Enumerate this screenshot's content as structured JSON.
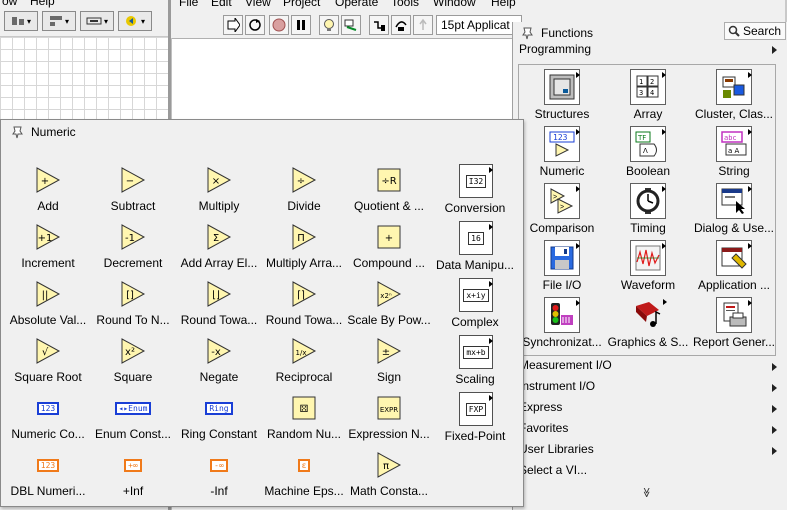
{
  "left_window": {
    "menu": [
      "ow",
      "Help"
    ]
  },
  "main_window": {
    "menu": [
      "File",
      "Edit",
      "View",
      "Project",
      "Operate",
      "Tools",
      "Window",
      "Help"
    ],
    "font_select": "15pt Applicat"
  },
  "functions_palette": {
    "title": "Functions",
    "search_label": "Search",
    "category": "Programming",
    "items": [
      {
        "label": "Structures",
        "icon": "structures-icon"
      },
      {
        "label": "Array",
        "icon": "array-icon"
      },
      {
        "label": "Cluster, Clas...",
        "icon": "cluster-icon"
      },
      {
        "label": "Numeric",
        "icon": "numeric-icon"
      },
      {
        "label": "Boolean",
        "icon": "boolean-icon"
      },
      {
        "label": "String",
        "icon": "string-icon"
      },
      {
        "label": "Comparison",
        "icon": "comparison-icon"
      },
      {
        "label": "Timing",
        "icon": "timing-icon"
      },
      {
        "label": "Dialog & Use...",
        "icon": "dialog-icon"
      },
      {
        "label": "File I/O",
        "icon": "file-io-icon"
      },
      {
        "label": "Waveform",
        "icon": "waveform-icon"
      },
      {
        "label": "Application ...",
        "icon": "application-icon"
      },
      {
        "label": "Synchronizat...",
        "icon": "synchronization-icon"
      },
      {
        "label": "Graphics & S...",
        "icon": "graphics-icon"
      },
      {
        "label": "Report Gener...",
        "icon": "report-icon"
      }
    ],
    "list": [
      "Measurement I/O",
      "Instrument I/O",
      "Express",
      "Favorites",
      "User Libraries",
      "Select a VI..."
    ],
    "more_glyph": "≫"
  },
  "numeric_palette": {
    "title": "Numeric",
    "items": [
      {
        "label": "Add",
        "glyph": "+"
      },
      {
        "label": "Subtract",
        "glyph": "−"
      },
      {
        "label": "Multiply",
        "glyph": "×"
      },
      {
        "label": "Divide",
        "glyph": "÷"
      },
      {
        "label": "Quotient & ...",
        "glyph": "÷R"
      },
      {
        "label": "Conversion",
        "glyph": "I32"
      },
      {
        "label": "Increment",
        "glyph": "+1"
      },
      {
        "label": "Decrement",
        "glyph": "-1"
      },
      {
        "label": "Add Array El...",
        "glyph": "Σ"
      },
      {
        "label": "Multiply Arra...",
        "glyph": "Π"
      },
      {
        "label": "Compound ...",
        "glyph": "+"
      },
      {
        "label": "Data Manipu...",
        "glyph": "16"
      },
      {
        "label": "Absolute Val...",
        "glyph": "||"
      },
      {
        "label": "Round To N...",
        "glyph": "[]"
      },
      {
        "label": "Round Towa...",
        "glyph": "⌊⌋"
      },
      {
        "label": "Round Towa...",
        "glyph": "⌈⌉"
      },
      {
        "label": "Scale By Pow...",
        "glyph": "x2ⁿ"
      },
      {
        "label": "Complex",
        "glyph": "x+iy"
      },
      {
        "label": "Square Root",
        "glyph": "√"
      },
      {
        "label": "Square",
        "glyph": "x²"
      },
      {
        "label": "Negate",
        "glyph": "-x"
      },
      {
        "label": "Reciprocal",
        "glyph": "1/x"
      },
      {
        "label": "Sign",
        "glyph": "±"
      },
      {
        "label": "Scaling",
        "glyph": "mx+b"
      },
      {
        "label": "Numeric Co...",
        "glyph": "123",
        "const_color": "#1a3fd6"
      },
      {
        "label": "Enum Const...",
        "glyph": "◂▸Enum",
        "const_color": "#1a3fd6"
      },
      {
        "label": "Ring Constant",
        "glyph": "Ring",
        "const_color": "#1a3fd6"
      },
      {
        "label": "Random Nu...",
        "glyph": "⚄"
      },
      {
        "label": "Expression N...",
        "glyph": "EXPR"
      },
      {
        "label": "Fixed-Point",
        "glyph": "FXP"
      },
      {
        "label": "DBL Numeri...",
        "glyph": "123",
        "const_color": "#f07a1a"
      },
      {
        "label": "+Inf",
        "glyph": "+∞",
        "const_color": "#f07a1a"
      },
      {
        "label": "-Inf",
        "glyph": "-∞",
        "const_color": "#f07a1a"
      },
      {
        "label": "Machine Eps...",
        "glyph": "ε",
        "const_color": "#f07a1a"
      },
      {
        "label": "Math Consta...",
        "glyph": "π"
      }
    ]
  }
}
